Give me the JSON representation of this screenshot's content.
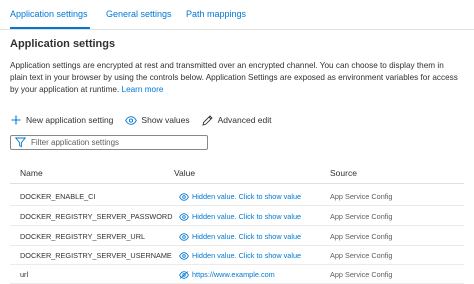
{
  "tabs": [
    {
      "label": "Application settings"
    },
    {
      "label": "General settings"
    },
    {
      "label": "Path mappings"
    }
  ],
  "title": "Application settings",
  "description": {
    "text": "Application settings are encrypted at rest and transmitted over an encrypted channel. You can choose to display them in plain text in your browser by using the controls below. Application Settings are exposed as environment variables for access by your application at runtime.",
    "link": "Learn more"
  },
  "toolbar": {
    "new_label": "New application setting",
    "show_label": "Show values",
    "advanced_label": "Advanced edit"
  },
  "filter": {
    "placeholder": "Filter application settings"
  },
  "table": {
    "headers": {
      "name": "Name",
      "value": "Value",
      "source": "Source"
    },
    "rows": [
      {
        "name": "DOCKER_ENABLE_CI",
        "value": "Hidden value. Click to show value",
        "source": "App Service Config"
      },
      {
        "name": "DOCKER_REGISTRY_SERVER_PASSWORD",
        "value": "Hidden value. Click to show value",
        "source": "App Service Config"
      },
      {
        "name": "DOCKER_REGISTRY_SERVER_URL",
        "value": "Hidden value. Click to show value",
        "source": "App Service Config"
      },
      {
        "name": "DOCKER_REGISTRY_SERVER_USERNAME",
        "value": "Hidden value. Click to show value",
        "source": "App Service Config"
      },
      {
        "name": "url",
        "value": "https://www.example.com",
        "source": "App Service Config"
      }
    ]
  },
  "icons": {
    "new": "plus-icon",
    "show": "eye-icon",
    "advanced": "pencil-icon",
    "filter": "filter-icon",
    "value_hidden": "eye-icon",
    "value_visible": "eye-icon"
  },
  "colors": {
    "accent": "#0078d4",
    "text": "#323130",
    "muted": "#605e5c",
    "border": "#e1dfdd"
  }
}
